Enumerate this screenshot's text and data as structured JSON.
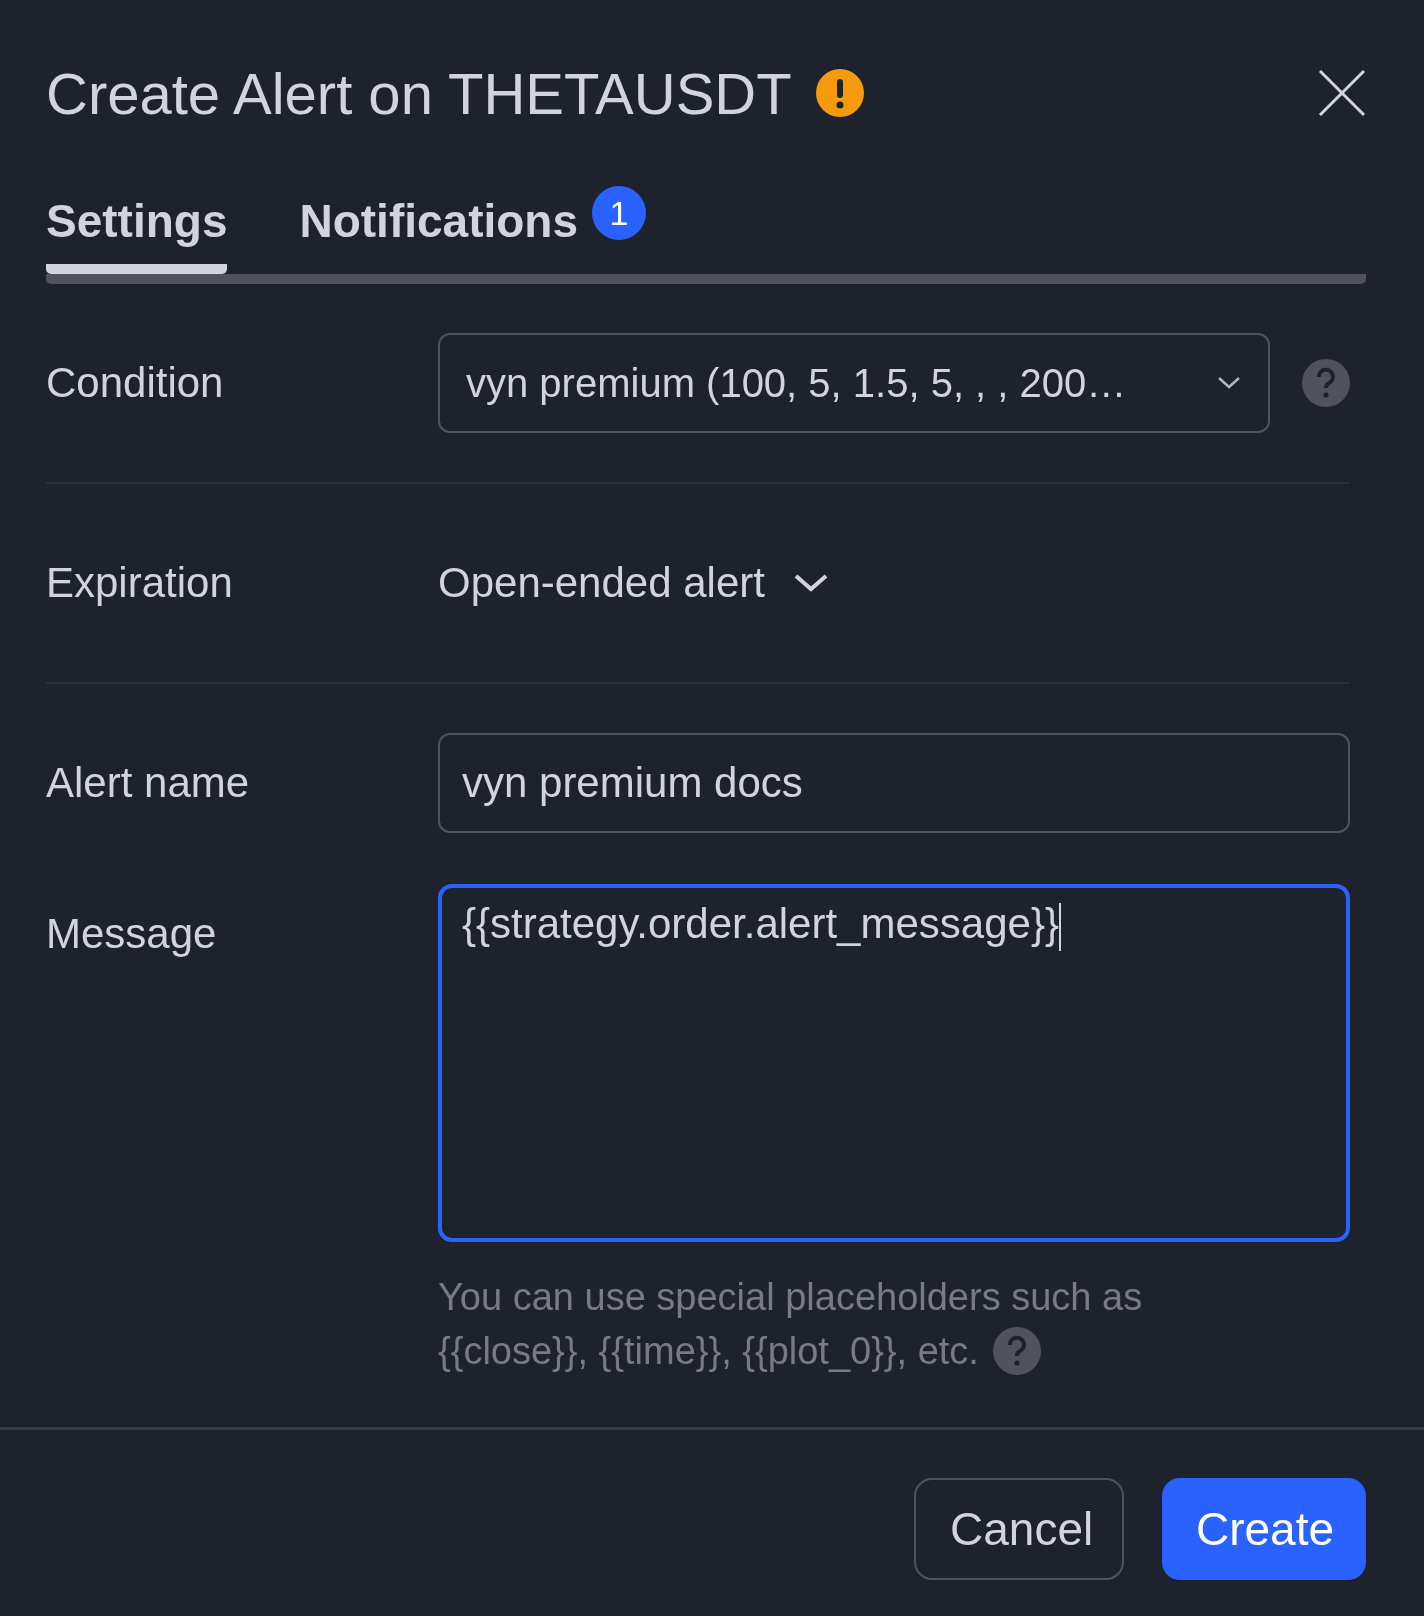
{
  "dialog": {
    "title": "Create Alert on THETAUSDT",
    "warning": true
  },
  "tabs": [
    {
      "label": "Settings",
      "selected": true
    },
    {
      "label": "Notifications",
      "selected": false,
      "badge": "1"
    }
  ],
  "fields": [
    {
      "kind": "select",
      "label": "Condition",
      "value": "vyn premium (100, 5, 1.5, 5, , , 200…",
      "help": true
    },
    {
      "kind": "dropdown",
      "label": "Expiration",
      "value": "Open-ended alert"
    },
    {
      "kind": "input",
      "label": "Alert name",
      "value": "vyn premium docs"
    },
    {
      "kind": "textarea",
      "label": "Message",
      "value": "{{strategy.order.alert_message}}",
      "focused": true,
      "hint_help": true,
      "hint": [
        "You can use special placeholders such as",
        "{{close}}, {{time}}, {{plot_0}}, etc."
      ]
    }
  ],
  "buttons": [
    {
      "kind": "secondary",
      "label": "Cancel"
    },
    {
      "kind": "primary",
      "label": "Create"
    }
  ]
}
